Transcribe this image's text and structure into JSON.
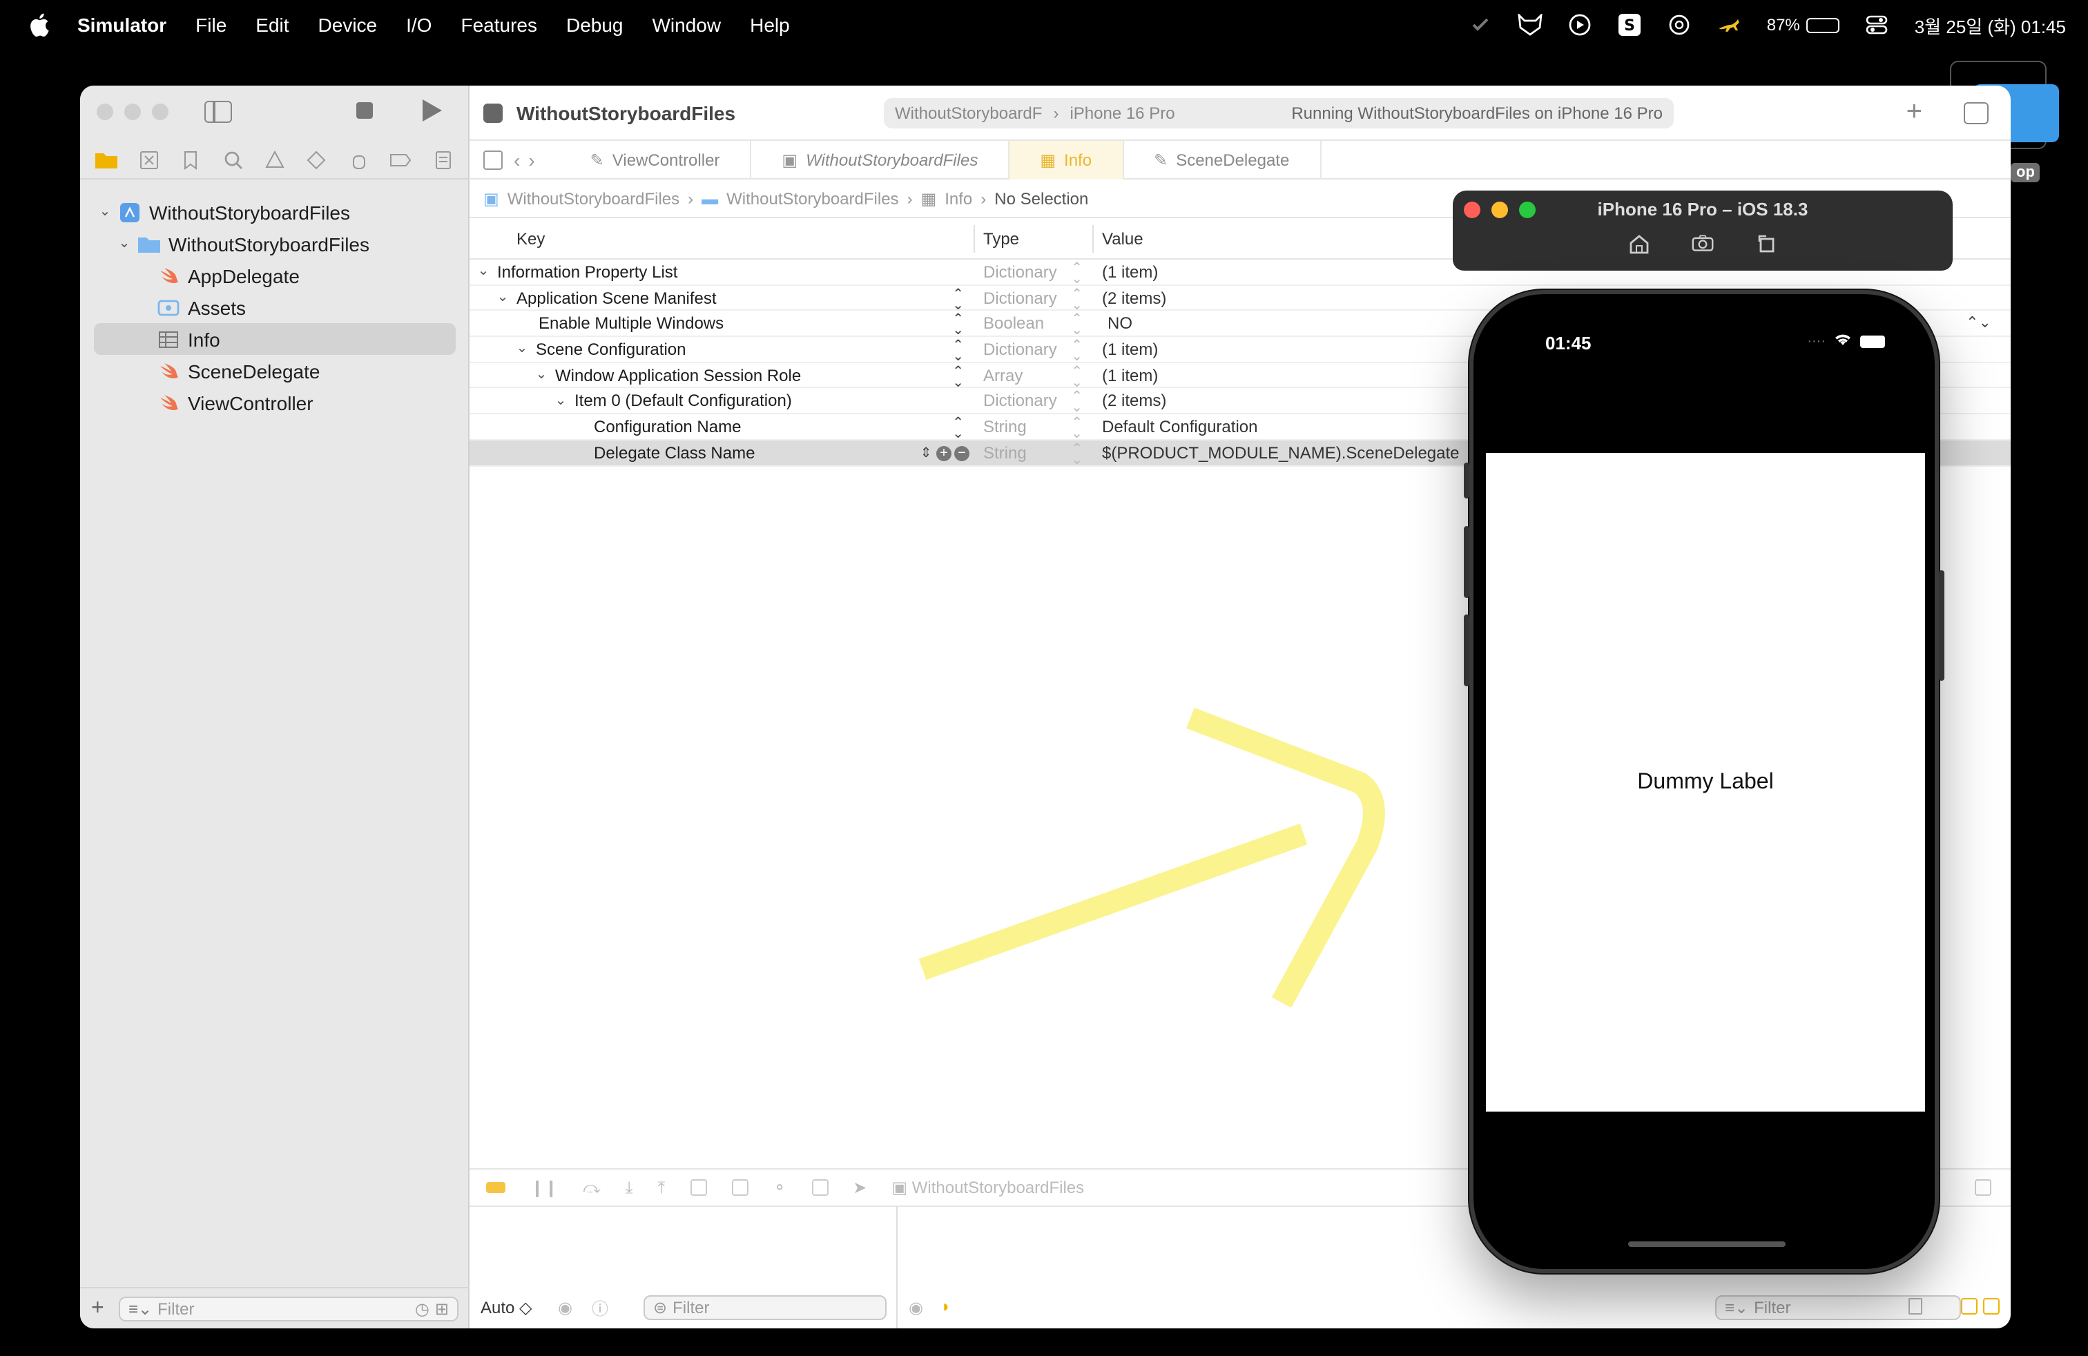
{
  "menubar": {
    "app": "Simulator",
    "items": [
      "File",
      "Edit",
      "Device",
      "I/O",
      "Features",
      "Debug",
      "Window",
      "Help"
    ],
    "battery_percent": "87%",
    "battery_level": 0.87,
    "clock": "3월 25일 (화) 01:45"
  },
  "desktop": {
    "folder_label": "op"
  },
  "xcode": {
    "project_title": "WithoutStoryboardFiles",
    "scheme": {
      "target": "WithoutStoryboardF",
      "device": "iPhone 16 Pro",
      "status": "Running WithoutStoryboardFiles on iPhone 16 Pro"
    },
    "tabs": [
      {
        "label": "ViewController",
        "icon": "swift-icon"
      },
      {
        "label": "WithoutStoryboardFiles",
        "icon": "project-icon"
      },
      {
        "label": "Info",
        "icon": "table-icon"
      },
      {
        "label": "SceneDelegate",
        "icon": "swift-icon"
      }
    ],
    "breadcrumb": [
      "WithoutStoryboardFiles",
      "WithoutStoryboardFiles",
      "Info",
      "No Selection"
    ],
    "navigator": {
      "items": [
        {
          "label": "WithoutStoryboardFiles",
          "icon": "project-icon"
        },
        {
          "label": "WithoutStoryboardFiles",
          "icon": "folder-icon"
        },
        {
          "label": "AppDelegate",
          "icon": "swift-icon"
        },
        {
          "label": "Assets",
          "icon": "assets-icon"
        },
        {
          "label": "Info",
          "icon": "table-icon"
        },
        {
          "label": "SceneDelegate",
          "icon": "swift-icon"
        },
        {
          "label": "ViewController",
          "icon": "swift-icon"
        }
      ],
      "filter_placeholder": "Filter"
    },
    "plist": {
      "headers": {
        "key": "Key",
        "type": "Type",
        "value": "Value"
      },
      "rows": [
        {
          "key": "Information Property List",
          "type": "Dictionary",
          "value": "(1 item)"
        },
        {
          "key": "Application Scene Manifest",
          "type": "Dictionary",
          "value": "(2 items)"
        },
        {
          "key": "Enable Multiple Windows",
          "type": "Boolean",
          "value": "NO"
        },
        {
          "key": "Scene Configuration",
          "type": "Dictionary",
          "value": "(1 item)"
        },
        {
          "key": "Window Application Session Role",
          "type": "Array",
          "value": "(1 item)"
        },
        {
          "key": "Item 0 (Default Configuration)",
          "type": "Dictionary",
          "value": "(2 items)"
        },
        {
          "key": "Configuration Name",
          "type": "String",
          "value": "Default Configuration"
        },
        {
          "key": "Delegate Class Name",
          "type": "String",
          "value": "$(PRODUCT_MODULE_NAME).SceneDelegate"
        }
      ]
    },
    "debug": {
      "target": "WithoutStoryboardFiles",
      "auto_label": "Auto ◇",
      "filter_placeholder": "Filter"
    }
  },
  "simulator": {
    "title": "iPhone 16 Pro – iOS 18.3",
    "time": "01:45",
    "label": "Dummy Label"
  },
  "colors": {
    "accent": "#f0b400",
    "annotation": "#fbf282",
    "close": "#ff5f57",
    "minimize": "#febc2e",
    "zoom": "#28c840"
  }
}
